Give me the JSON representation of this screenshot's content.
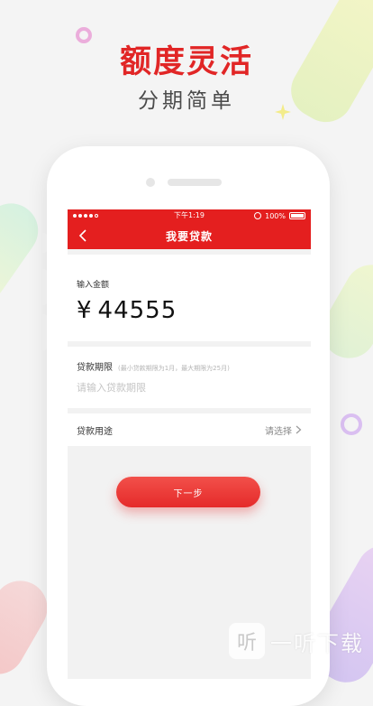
{
  "promo": {
    "headline": "额度灵活",
    "subline": "分期简单"
  },
  "colors": {
    "brand_red": "#e41f1f",
    "headline_red": "#e12626",
    "button_gradient_top": "#f2504a",
    "button_gradient_bottom": "#e52a2a"
  },
  "statusbar": {
    "time": "下午1:19",
    "battery": "100%"
  },
  "navbar": {
    "title": "我要贷款",
    "back_icon": "chevron-left-icon"
  },
  "form": {
    "amount_label": "输入金额",
    "currency": "¥",
    "amount_value": "44555",
    "term_label": "贷款期限",
    "term_hint": "(最小贷款期限为1月，最大期限为25月)",
    "term_placeholder": "请输入贷款期限",
    "purpose_label": "贷款用途",
    "purpose_select": "请选择",
    "next_button": "下一步"
  },
  "watermark": {
    "logo_glyph": "听",
    "text": "一听下载"
  }
}
